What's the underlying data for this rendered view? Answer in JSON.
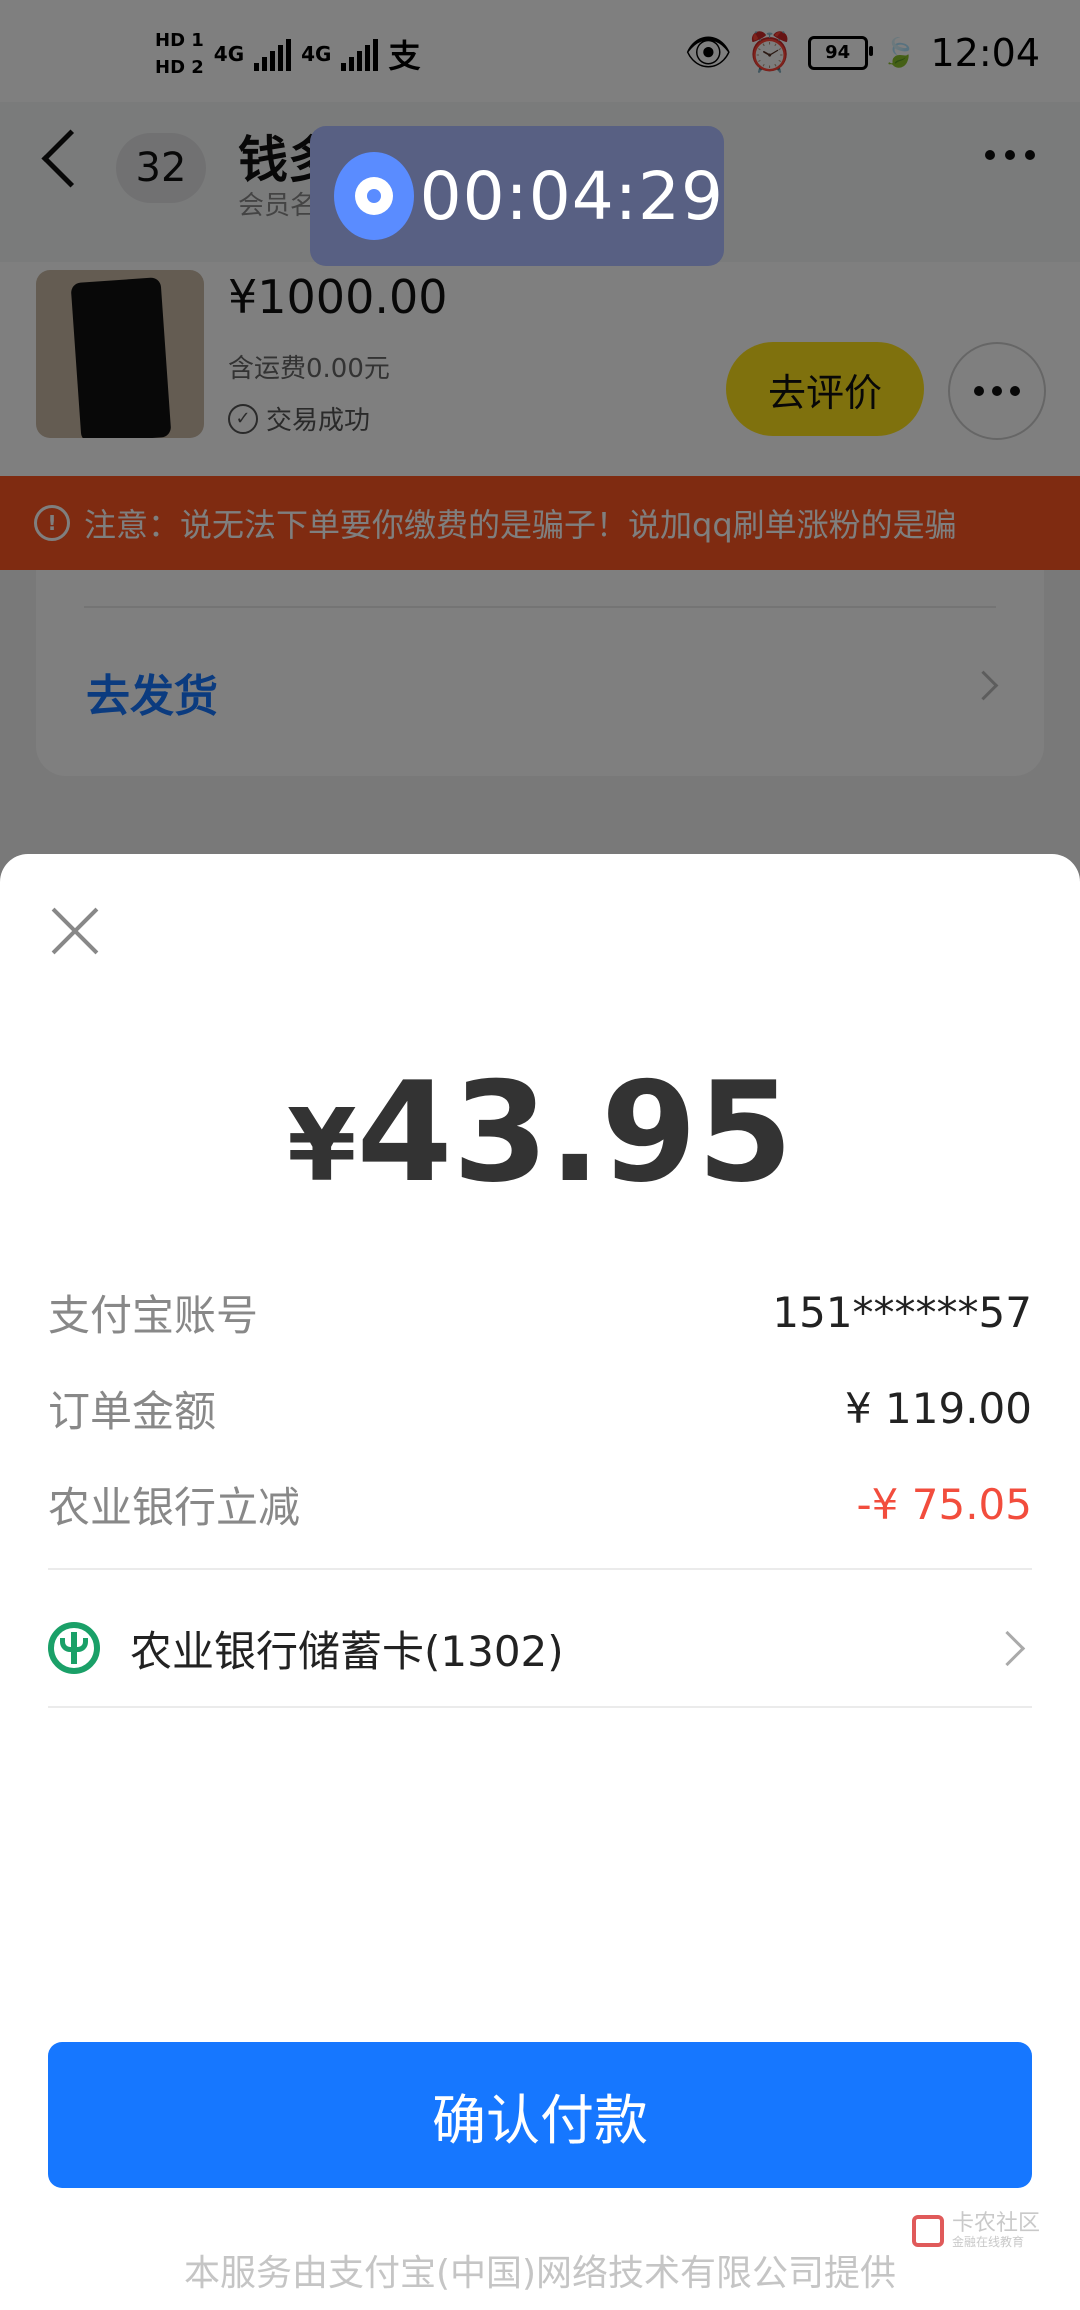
{
  "status_bar": {
    "hd1": "HD 1",
    "hd2": "HD 2",
    "net1": "4G",
    "net2": "4G",
    "alipay_glyph": "支",
    "battery": "94",
    "time": "12:04",
    "icons": [
      "eye-icon",
      "alarm-icon",
      "battery-icon",
      "leaf-icon"
    ]
  },
  "chat": {
    "unread_count": "32",
    "name": "钱多",
    "subtitle": "会员名",
    "order": {
      "price": "¥1000.00",
      "shipping": "含运费0.00元",
      "status": "交易成功",
      "review_button": "去评价"
    },
    "warning": "注意：说无法下单要你缴费的是骗子！说加qq刷单涨粉的是骗",
    "ship_link": "去发货"
  },
  "timer": {
    "time": "00:04:29"
  },
  "payment": {
    "amount_currency": "¥",
    "amount": "43.95",
    "rows": [
      {
        "label": "支付宝账号",
        "value": "151******57"
      },
      {
        "label": "订单金额",
        "value": "¥ 119.00"
      },
      {
        "label": "农业银行立减",
        "value": "-¥ 75.05"
      }
    ],
    "method": "农业银行储蓄卡(1302)",
    "confirm_button": "确认付款",
    "footer": "本服务由支付宝(中国)网络技术有限公司提供"
  },
  "watermark": {
    "title": "卡农社区",
    "subtitle": "金融在线教育"
  },
  "colors": {
    "primary_blue": "#1677ff",
    "warning_orange": "#ff5722",
    "discount_red": "#f24d3d",
    "review_yellow": "#ffe21a",
    "abc_green": "#1aa068"
  }
}
